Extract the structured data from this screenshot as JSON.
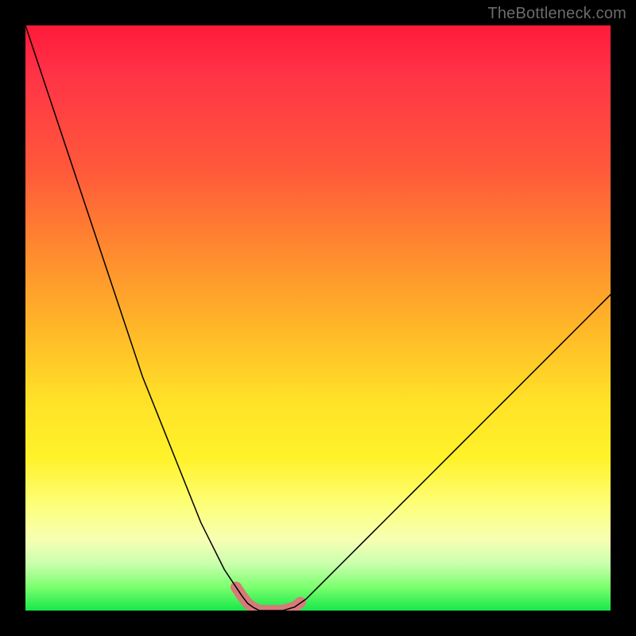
{
  "watermark": {
    "text": "TheBottleneck.com"
  },
  "chart_data": {
    "type": "line",
    "title": "",
    "xlabel": "",
    "ylabel": "",
    "xlim": [
      0,
      100
    ],
    "ylim": [
      0,
      100
    ],
    "grid": false,
    "series": [
      {
        "name": "bottleneck-curve",
        "color": "#000000",
        "x": [
          0,
          2,
          4,
          6,
          8,
          10,
          12,
          14,
          16,
          18,
          20,
          22,
          24,
          26,
          28,
          30,
          32,
          34,
          36,
          37,
          38,
          39,
          40,
          42,
          44,
          46,
          48,
          50,
          52,
          54,
          58,
          62,
          66,
          70,
          74,
          78,
          82,
          86,
          90,
          94,
          98,
          100
        ],
        "y": [
          100,
          94,
          88,
          82,
          76,
          70,
          64,
          58,
          52,
          46,
          40,
          35,
          30,
          25,
          20,
          15,
          11,
          7,
          4,
          2.5,
          1.2,
          0.5,
          0,
          0,
          0,
          0.6,
          2,
          4,
          6,
          8,
          12,
          16,
          20,
          24,
          28,
          32,
          36,
          40,
          44,
          48,
          52,
          54
        ]
      },
      {
        "name": "flat-bottom-marker",
        "color": "#d77a7a",
        "stroke_width_px": 14,
        "x": [
          36,
          37,
          38,
          39,
          40,
          42,
          44,
          46,
          47
        ],
        "y": [
          4,
          2.5,
          1.2,
          0.5,
          0,
          0,
          0,
          0.6,
          1.4
        ]
      }
    ],
    "annotations": []
  }
}
